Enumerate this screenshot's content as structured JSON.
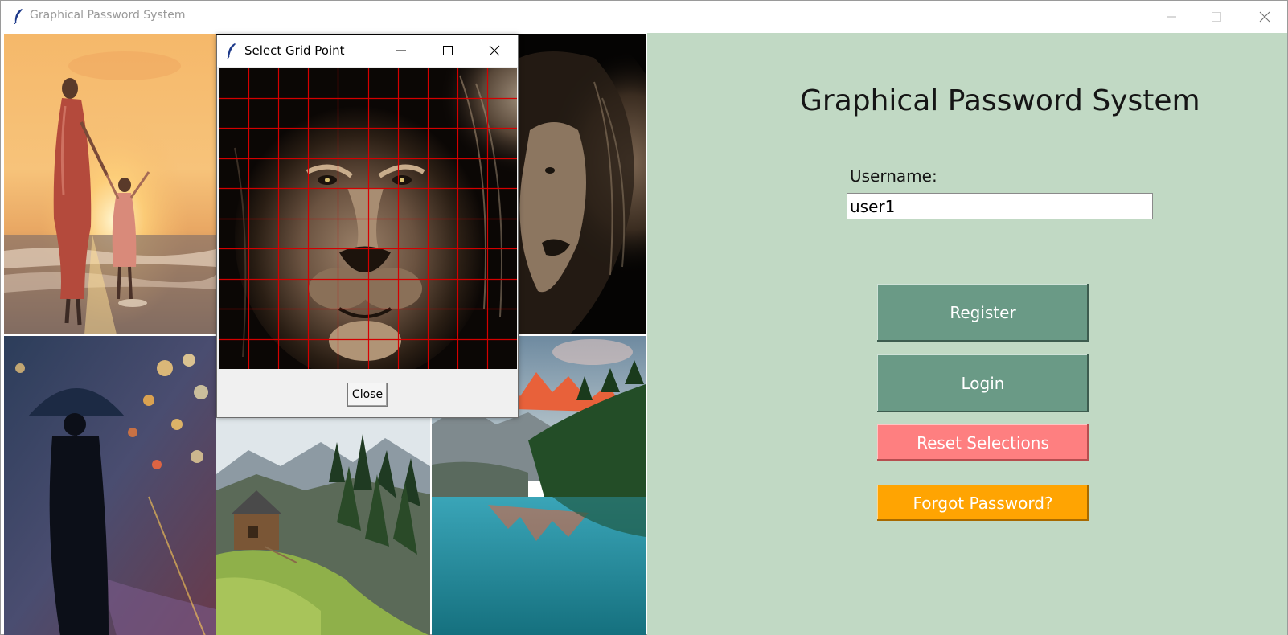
{
  "window": {
    "title": "Graphical Password System"
  },
  "dialog": {
    "title": "Select Grid Point",
    "close_label": "Close",
    "grid_color": "#d40000"
  },
  "panel": {
    "heading": "Graphical Password System",
    "username_label": "Username:",
    "username_value": "user1",
    "register_label": "Register",
    "login_label": "Login",
    "reset_label": "Reset Selections",
    "forgot_label": "Forgot Password?"
  },
  "colors": {
    "panel_bg": "#c1d9c4",
    "primary_button": "#6a9a86",
    "reset_button": "#fe7f80",
    "forgot_button": "#ffa402"
  },
  "images": [
    "mother-and-child-beach-sunset",
    "lion-face-dark",
    "person-with-umbrella-city-night",
    "mountain-cabin-forest",
    "mountain-lake-reflection"
  ]
}
